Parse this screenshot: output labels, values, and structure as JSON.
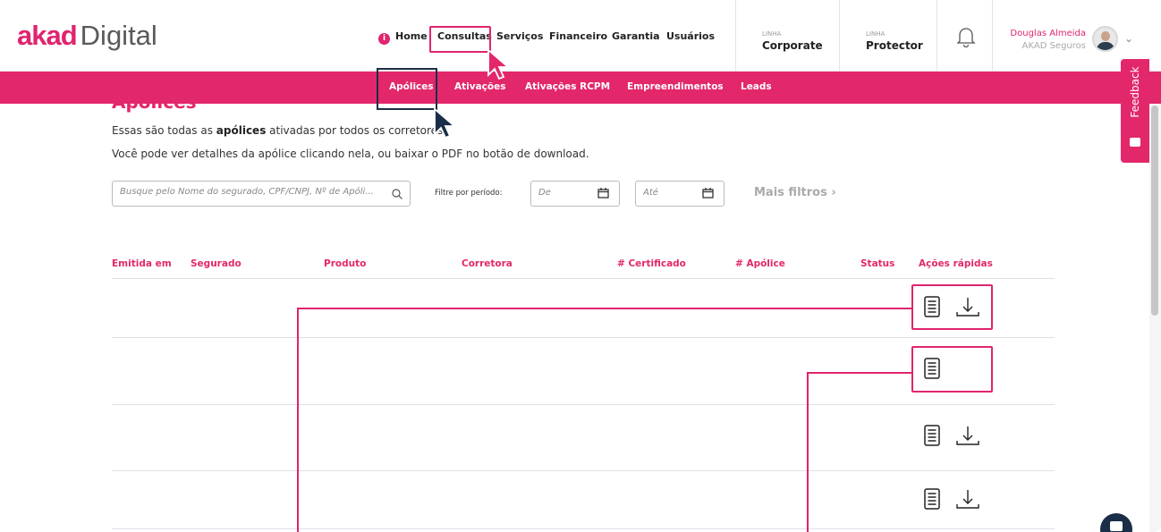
{
  "header": {
    "logo_brand": "akad",
    "logo_sub": "Digital",
    "nav": [
      "Home",
      "Consultas",
      "Serviços",
      "Financeiro",
      "Garantia",
      "Usuários"
    ],
    "linha_corporate_small": "LINHA",
    "linha_corporate_big": "Corporate",
    "linha_protector_small": "LINHA",
    "linha_protector_big": "Protector",
    "user_name": "Douglas Almeida",
    "user_company": "AKAD Seguros"
  },
  "subnav": [
    "Apólices",
    "Ativações",
    "Ativações RCPM",
    "Empreendimentos",
    "Leads"
  ],
  "feedback_label": "Feedback",
  "page": {
    "title": "Apólices",
    "intro_1_prefix": "Essas são todas as ",
    "intro_1_bold": "apólices",
    "intro_1_suffix": " ativadas por todos os corretores.",
    "intro_2": "Você pode ver detalhes da apólice clicando nela, ou baixar o PDF no botão de download."
  },
  "filters": {
    "search_placeholder": "Busque pelo Nome do segurado, CPF/CNPJ, Nº de Apóli...",
    "period_label": "Filtre por período:",
    "from_placeholder": "De",
    "to_placeholder": "Até",
    "more_filters": "Mais filtros ›"
  },
  "table": {
    "columns": [
      "Emitida em",
      "Segurado",
      "Produto",
      "Corretora",
      "# Certificado",
      "# Apólice",
      "Status",
      "Ações rápidas"
    ],
    "rows": [
      {
        "actions": [
          "document-icon",
          "download-icon"
        ]
      },
      {
        "actions": [
          "document-icon"
        ]
      },
      {
        "actions": [
          "document-icon",
          "download-icon"
        ]
      },
      {
        "actions": [
          "document-icon",
          "download-icon"
        ]
      }
    ]
  },
  "colors": {
    "brand_pink": "#e3276b",
    "navy": "#1b2e47",
    "annotation": "#e0246e"
  }
}
